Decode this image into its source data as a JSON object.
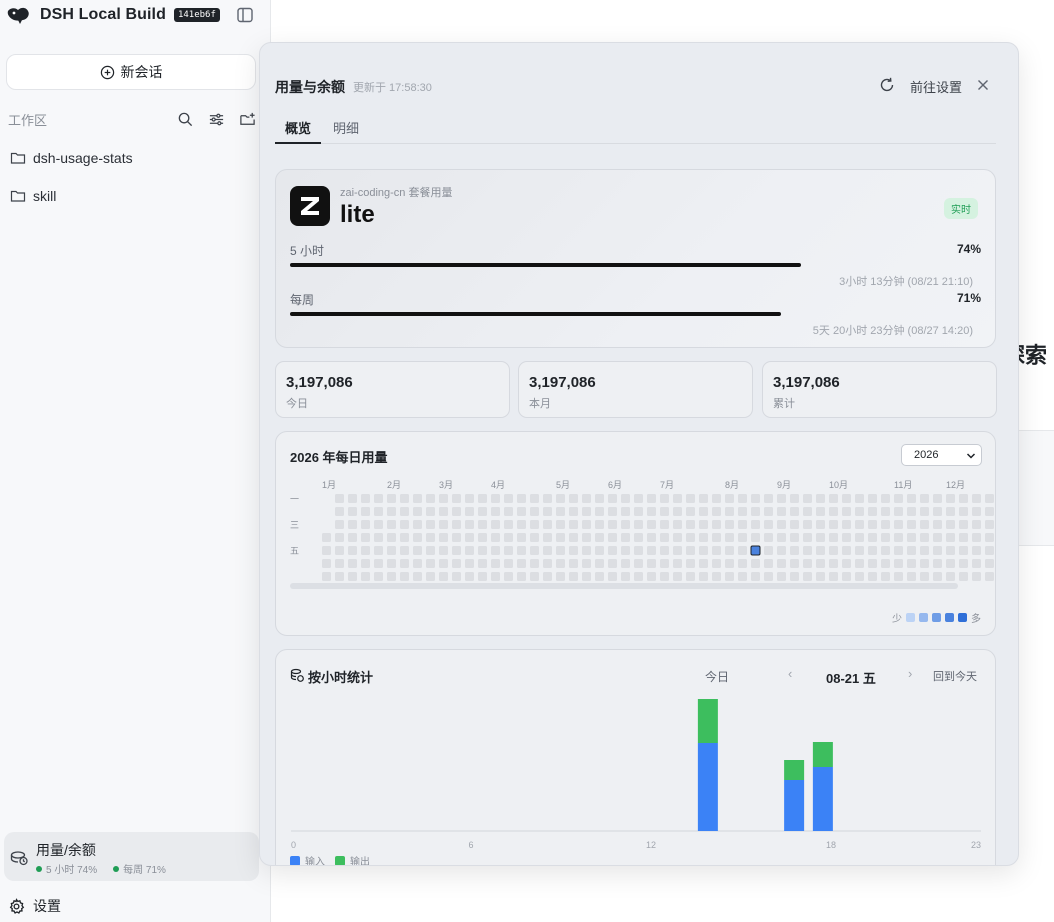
{
  "sidebar": {
    "brand": "DSH Local Build",
    "version_tag": "141eb6f",
    "new_chat_label": "新会话",
    "workspace_label": "工作区",
    "folders": [
      "dsh-usage-stats",
      "skill"
    ],
    "usage_nav": {
      "label": "用量/余额",
      "sub_5h": "5 小时 74%",
      "sub_week": "每周 71%"
    },
    "settings_label": "设置"
  },
  "background": {
    "heading_fragment": "探索"
  },
  "panel": {
    "title": "用量与余额",
    "updated": "更新于 17:58:30",
    "goto_settings": "前往设置",
    "tabs": [
      {
        "label": "概览",
        "active": true
      },
      {
        "label": "明细",
        "active": false
      }
    ],
    "plan": {
      "provider": "zai-coding-cn 套餐用量",
      "name": "lite",
      "badge": "实时",
      "quotas": [
        {
          "label": "5 小时",
          "percent": 74,
          "percent_text": "74%",
          "reset": "3小时 13分钟 (08/21 21:10)"
        },
        {
          "label": "每周",
          "percent": 71,
          "percent_text": "71%",
          "reset": "5天 20小时 23分钟 (08/27 14:20)"
        }
      ]
    },
    "stats": [
      {
        "value": "3,197,086",
        "label": "今日"
      },
      {
        "value": "3,197,086",
        "label": "本月"
      },
      {
        "value": "3,197,086",
        "label": "累计"
      }
    ],
    "heatmap": {
      "title": "2026 年每日用量",
      "year_selected": "2026",
      "months": [
        "1月",
        "2月",
        "3月",
        "4月",
        "5月",
        "6月",
        "7月",
        "8月",
        "9月",
        "10月",
        "11月",
        "12月"
      ],
      "weekday_labels": [
        "一",
        "三",
        "五"
      ],
      "legend_less": "少",
      "legend_more": "多",
      "active_day": "08-21",
      "colors": {
        "empty": "#dcdee2",
        "scale": [
          "#bcd3f5",
          "#96b8ee",
          "#6f9de6",
          "#4a82de",
          "#2f6fd8"
        ]
      }
    },
    "hourly": {
      "title": "按小时统计",
      "today_label": "今日",
      "prev": "‹",
      "date": "08-21 五",
      "next": "›",
      "back_today": "回到今天",
      "legend_input": "输入",
      "legend_output": "输出",
      "colors": {
        "input": "#3b82f6",
        "output": "#3dbe5e"
      }
    }
  },
  "chart_data": {
    "type": "bar",
    "title": "按小时统计",
    "x_ticks": [
      "0",
      "6",
      "12",
      "18",
      "23"
    ],
    "x": [
      0,
      1,
      2,
      3,
      4,
      5,
      6,
      7,
      8,
      9,
      10,
      11,
      12,
      13,
      14,
      15,
      16,
      17,
      18,
      19,
      20,
      21,
      22,
      23
    ],
    "series": [
      {
        "name": "输入",
        "values": [
          0,
          0,
          0,
          0,
          0,
          0,
          0,
          0,
          0,
          0,
          0,
          0,
          0,
          0,
          88,
          0,
          0,
          51,
          64,
          0,
          0,
          0,
          0,
          0
        ]
      },
      {
        "name": "输出",
        "values": [
          0,
          0,
          0,
          0,
          0,
          0,
          0,
          0,
          0,
          0,
          0,
          0,
          0,
          0,
          44,
          0,
          0,
          20,
          25,
          0,
          0,
          0,
          0,
          0
        ]
      }
    ],
    "stacked": true,
    "ylim": [
      0,
      140
    ],
    "grid": false,
    "legend": "bottom-left"
  }
}
